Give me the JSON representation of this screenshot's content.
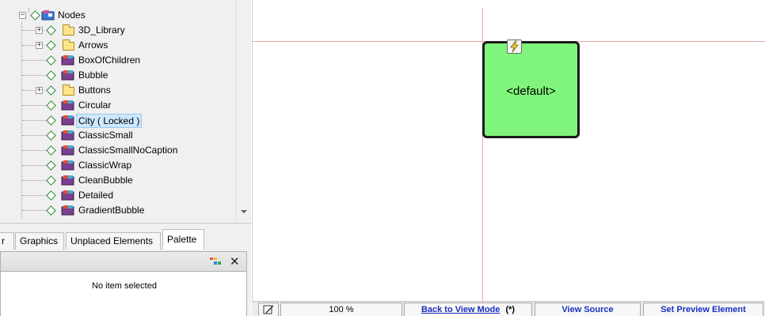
{
  "tree": {
    "root": {
      "label": "Nodes",
      "icon": "node-root-icon"
    },
    "items": [
      {
        "label": "3D_Library",
        "kind": "folder",
        "expandable": true
      },
      {
        "label": "Arrows",
        "kind": "folder",
        "expandable": true
      },
      {
        "label": "BoxOfChildren",
        "kind": "node"
      },
      {
        "label": "Bubble",
        "kind": "node"
      },
      {
        "label": "Buttons",
        "kind": "folder",
        "expandable": true
      },
      {
        "label": "Circular",
        "kind": "node"
      },
      {
        "label": "City ( Locked )",
        "kind": "node",
        "selected": true
      },
      {
        "label": "ClassicSmall",
        "kind": "node"
      },
      {
        "label": "ClassicSmallNoCaption",
        "kind": "node"
      },
      {
        "label": "ClassicWrap",
        "kind": "node"
      },
      {
        "label": "CleanBubble",
        "kind": "node"
      },
      {
        "label": "Detailed",
        "kind": "node"
      },
      {
        "label": "GradientBubble",
        "kind": "node"
      }
    ]
  },
  "tabs": [
    {
      "label": "r"
    },
    {
      "label": "Graphics"
    },
    {
      "label": "Unplaced Elements"
    },
    {
      "label": "Palette",
      "active": true
    }
  ],
  "palette": {
    "empty_message": "No item selected",
    "close_glyph": "✕"
  },
  "canvas": {
    "node_label": "<default>",
    "node_color": "#80f57c",
    "guide_color": "#f3a5a5"
  },
  "statusbar": {
    "zoom": "100 %",
    "back_to_view": "Back to View Mode",
    "modified_marker": "(*)",
    "view_source": "View Source",
    "set_preview": "Set Preview Element"
  },
  "colors": {
    "selection_bg": "#cde8ff",
    "link": "#1a2fbf"
  }
}
